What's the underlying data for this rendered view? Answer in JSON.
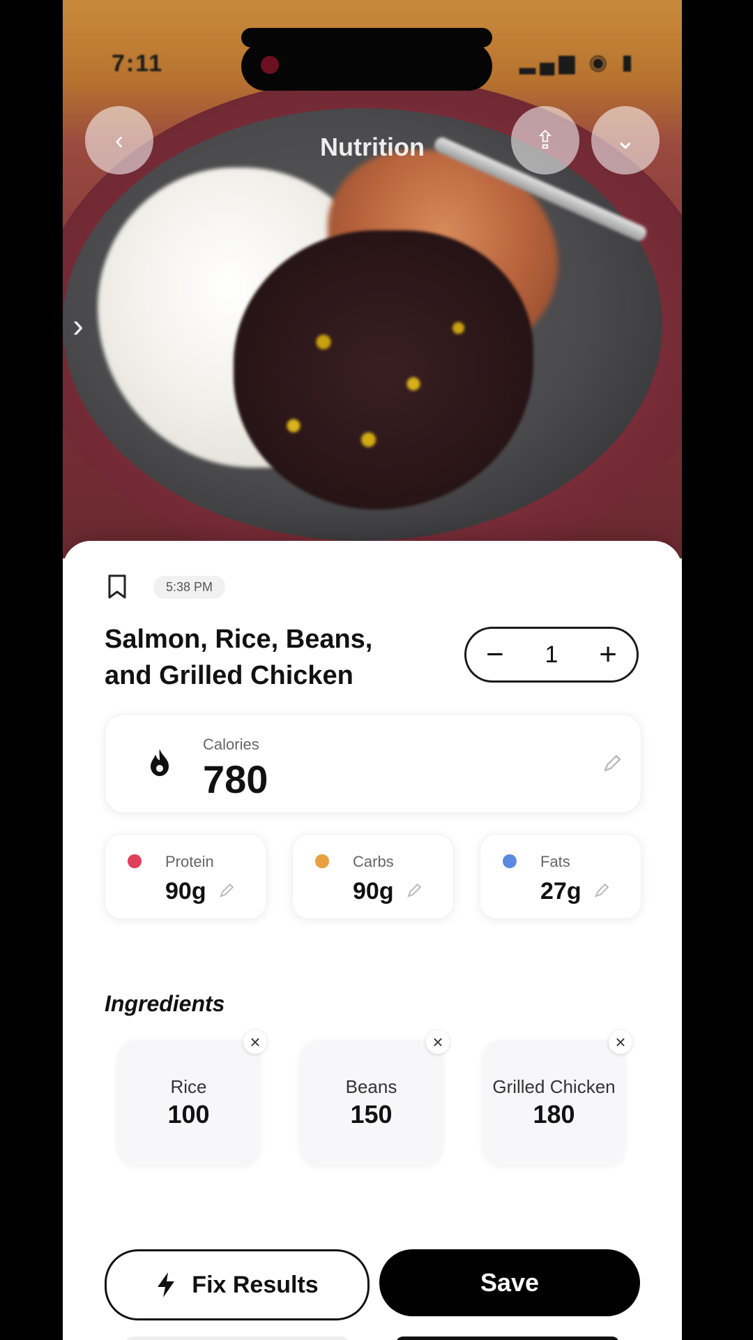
{
  "status_bar": {
    "time": "7:11",
    "icons": "▂▄▆ ◉ ▮"
  },
  "nav": {
    "title": "Nutrition",
    "back_glyph": "‹",
    "share_glyph": "⇪",
    "more_glyph": "⌄"
  },
  "meal": {
    "time": "5:38 PM",
    "title": "Salmon, Rice, Beans, and Grilled Chicken",
    "quantity": "1",
    "minus": "−",
    "plus": "+"
  },
  "calories": {
    "label": "Calories",
    "value": "780"
  },
  "macros": [
    {
      "label": "Protein",
      "value": "90g",
      "color": "#e0405a"
    },
    {
      "label": "Carbs",
      "value": "90g",
      "color": "#e8a040"
    },
    {
      "label": "Fats",
      "value": "27g",
      "color": "#5a8ae0"
    }
  ],
  "ingredients": {
    "title": "Ingredients",
    "items": [
      {
        "name": "Rice",
        "amount": "100"
      },
      {
        "name": "Beans",
        "amount": "150"
      },
      {
        "name": "Grilled Chicken",
        "amount": "180"
      }
    ],
    "remove_glyph": "×"
  },
  "actions": {
    "fix_label": "Fix Results",
    "save_label": "Save"
  }
}
